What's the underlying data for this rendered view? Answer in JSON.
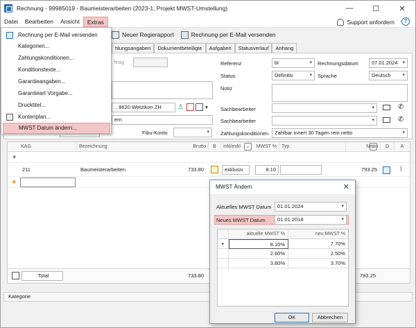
{
  "window": {
    "title": "Rechnung - 99985019 - Baumeisterarbeiten (2023-1, Projekt MWST-Umstellung)",
    "minimize": "—",
    "maximize": "☐",
    "close": "✕"
  },
  "menubar": {
    "items": [
      "Datei",
      "Bearbeiten",
      "Ansicht",
      "Extras"
    ],
    "support": "Support anfordern",
    "help": "?"
  },
  "toolbar": {
    "new_regierapport": "Neuer Regierapport",
    "send_email": "Rechnung per E-Mail versenden"
  },
  "tabs": [
    "hlungsangaben",
    "Dokumentbeteiligte",
    "Aufgaben",
    "Statusverlauf",
    "Anhang"
  ],
  "extras_menu": {
    "items": [
      "Rechnung per E-Mail versenden",
      "Kategorien...",
      "Zahlungskonditionen...",
      "Konditionstexte...",
      "Garantieangaben...",
      "Garantieart Vorgabe...",
      "Drucktitel...",
      "Kontenplan...",
      "MWST Datum ändern..."
    ]
  },
  "form": {
    "auftrag_label": "ftrag",
    "address": "., 8620 Wetzikon ZH",
    "obj": "ern",
    "fibu_label": "Fibu-Konto",
    "referenz_label": "Referenz",
    "referenz_value": "bl",
    "rechnungsdatum_label": "Rechnungsdatum",
    "rechnungsdatum_value": "07.01.2024",
    "status_label": "Status",
    "status_value": "Definitiv",
    "sprache_label": "Sprache",
    "sprache_value": "Deutsch",
    "notiz_label": "Notiz",
    "sachbearbeiter1_label": "Sachbearbeiter",
    "sachbearbeiter2_label": "Sachbearbeiter",
    "zahlungskonditionen_label": "Zahlungskonditionen",
    "zahlungskonditionen_value": "Zahlbar innert 30 Tagen rein netto"
  },
  "grid": {
    "headers": [
      "KAG",
      "Bezeichnung",
      "Brutto",
      "B",
      "inkl/exkl",
      "MWST %",
      "Typ",
      "Netto",
      "D",
      "A"
    ],
    "row": {
      "kag": "211",
      "bezeichnung": "Baumeisterarbeiten",
      "brutto": "733.80",
      "inkl": "exklusiv",
      "mwst": "8.10",
      "netto": "793.25"
    },
    "total_label": "Total",
    "total_brutto": "733.80",
    "total_netto": "793.25"
  },
  "bottom": {
    "kategorie": "Kategorie"
  },
  "dialog": {
    "title": "MWST Ändern",
    "close": "✕",
    "aktuelles_label": "Aktuelles MWST Datum",
    "aktuelles_value": "01.01.2024",
    "neues_label": "Neues MWST Datum",
    "neues_value": "01.01.2018",
    "col_aktuelle": "aktuelle MWST %",
    "col_neu": "neu MWST %",
    "rows": [
      {
        "aktuell": "8.10%",
        "neu": "7.70%"
      },
      {
        "aktuell": "2.60%",
        "neu": "2.50%"
      },
      {
        "aktuell": "3.80%",
        "neu": "3.70%"
      }
    ],
    "ok": "OK",
    "cancel": "Abbrechen"
  }
}
